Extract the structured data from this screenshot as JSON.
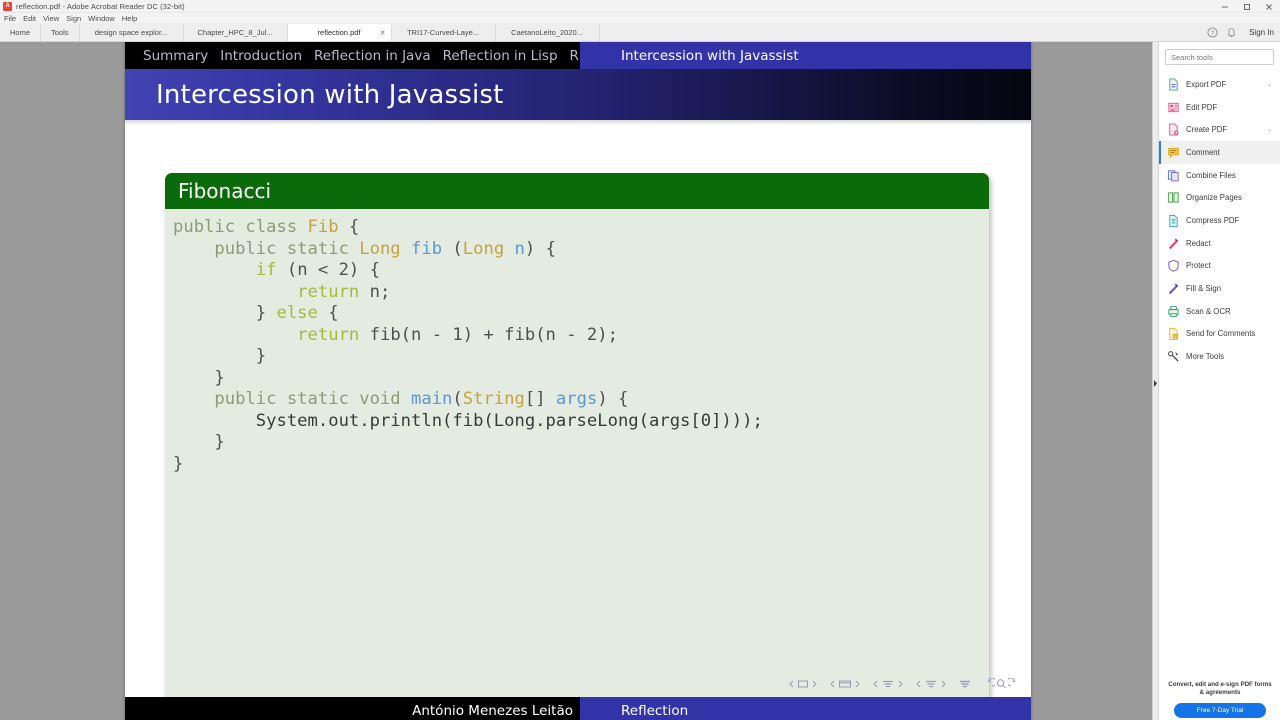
{
  "window": {
    "title": "reflection.pdf - Adobe Acrobat Reader DC (32-bit)",
    "app_icon": "pdf-icon",
    "minimize_label": "—",
    "restore_label": "❐",
    "close_label": "✕"
  },
  "menubar": {
    "items": [
      "File",
      "Edit",
      "View",
      "Sign",
      "Window",
      "Help"
    ]
  },
  "tabstrip": {
    "nav_tabs": [
      "Home",
      "Tools"
    ],
    "doc_tabs": [
      {
        "label": "design space explor...",
        "active": false
      },
      {
        "label": "Chapter_HPC_8_Jul...",
        "active": false
      },
      {
        "label": "reflection.pdf",
        "active": true,
        "close": "✕"
      },
      {
        "label": "TRI17-Curved-Laye...",
        "active": false
      },
      {
        "label": "CaetanoLeito_2020...",
        "active": false
      }
    ],
    "help_icon": "help-circle-icon",
    "bell_icon": "bell-icon",
    "signin_label": "Sign In"
  },
  "slide": {
    "nav_sections": [
      "Summary",
      "Introduction",
      "Reflection in Java",
      "Reflection in Lisp",
      "R"
    ],
    "nav_current": "Intercession with Javassist",
    "frame_title": "Intercession with Javassist",
    "block_title": "Fibonacci",
    "code_lines": [
      [
        {
          "t": "public class ",
          "c": "k"
        },
        {
          "t": "Fib",
          "c": "t"
        },
        {
          "t": " {",
          "c": "p"
        }
      ],
      [
        {
          "t": "    public static ",
          "c": "k"
        },
        {
          "t": "Long",
          "c": "t"
        },
        {
          "t": " ",
          "c": "p"
        },
        {
          "t": "fib",
          "c": "f"
        },
        {
          "t": " (",
          "c": "p"
        },
        {
          "t": "Long",
          "c": "t"
        },
        {
          "t": " ",
          "c": "p"
        },
        {
          "t": "n",
          "c": "f"
        },
        {
          "t": ") {",
          "c": "p"
        }
      ],
      [
        {
          "t": "        ",
          "c": "p"
        },
        {
          "t": "if",
          "c": "c"
        },
        {
          "t": " (n < 2) {",
          "c": "p"
        }
      ],
      [
        {
          "t": "            ",
          "c": "p"
        },
        {
          "t": "return",
          "c": "c"
        },
        {
          "t": " n;",
          "c": "p"
        }
      ],
      [
        {
          "t": "        } ",
          "c": "p"
        },
        {
          "t": "else",
          "c": "c"
        },
        {
          "t": " {",
          "c": "p"
        }
      ],
      [
        {
          "t": "            ",
          "c": "p"
        },
        {
          "t": "return",
          "c": "c"
        },
        {
          "t": " fib(n - 1) + fib(n - 2);",
          "c": "p"
        }
      ],
      [
        {
          "t": "        }",
          "c": "p"
        }
      ],
      [
        {
          "t": "    }",
          "c": "p"
        }
      ],
      [
        {
          "t": "    public static void ",
          "c": "k"
        },
        {
          "t": "main",
          "c": "f"
        },
        {
          "t": "(",
          "c": "p"
        },
        {
          "t": "String",
          "c": "t"
        },
        {
          "t": "[] ",
          "c": "p"
        },
        {
          "t": "args",
          "c": "f"
        },
        {
          "t": ") {",
          "c": "p"
        }
      ],
      [
        {
          "t": "        System.out.println(fib(Long.parseLong(args[0])));",
          "c": "n"
        }
      ],
      [
        {
          "t": "    }",
          "c": "p"
        }
      ],
      [
        {
          "t": "}",
          "c": "p"
        }
      ]
    ],
    "footer_author": "António Menezes Leitão",
    "footer_title": "Reflection",
    "colors": {
      "nav_highlight": "#3333a8",
      "block_header": "#0b6b0b",
      "block_body": "#e4ece2"
    }
  },
  "toolpanel": {
    "search_placeholder": "Search tools",
    "items": [
      {
        "label": "Export PDF",
        "icon": "export-pdf-icon",
        "chevron": "⌄",
        "selected": false
      },
      {
        "label": "Edit PDF",
        "icon": "edit-pdf-icon",
        "chevron": "",
        "selected": false
      },
      {
        "label": "Create PDF",
        "icon": "create-pdf-icon",
        "chevron": "⌄",
        "selected": false
      },
      {
        "label": "Comment",
        "icon": "comment-icon",
        "chevron": "",
        "selected": true
      },
      {
        "label": "Combine Files",
        "icon": "combine-files-icon",
        "chevron": "",
        "selected": false
      },
      {
        "label": "Organize Pages",
        "icon": "organize-pages-icon",
        "chevron": "",
        "selected": false
      },
      {
        "label": "Compress PDF",
        "icon": "compress-pdf-icon",
        "chevron": "",
        "selected": false
      },
      {
        "label": "Redact",
        "icon": "redact-icon",
        "chevron": "",
        "selected": false
      },
      {
        "label": "Protect",
        "icon": "protect-icon",
        "chevron": "",
        "selected": false
      },
      {
        "label": "Fill & Sign",
        "icon": "fill-sign-icon",
        "chevron": "",
        "selected": false
      },
      {
        "label": "Scan & OCR",
        "icon": "scan-ocr-icon",
        "chevron": "",
        "selected": false
      },
      {
        "label": "Send for Comments",
        "icon": "send-for-comments-icon",
        "chevron": "",
        "selected": false
      },
      {
        "label": "More Tools",
        "icon": "more-tools-icon",
        "chevron": "",
        "selected": false
      }
    ],
    "promo_text": "Convert, edit and e-sign PDF forms & agreements",
    "promo_button": "Free 7-Day Trial",
    "promo_color": "#1473e6"
  }
}
